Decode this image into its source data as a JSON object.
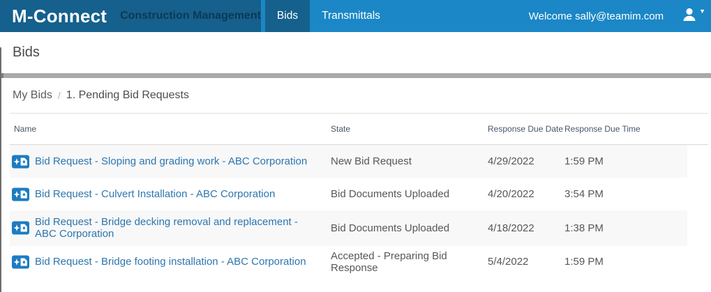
{
  "topbar": {
    "logo": "M-Connect",
    "app_name": "Construction Management",
    "nav": [
      {
        "label": "Bids",
        "active": true
      },
      {
        "label": "Transmittals",
        "active": false
      }
    ],
    "welcome": "Welcome sally@teamim.com",
    "user_icon": "user-icon",
    "caret_icon": "caret-down-icon",
    "bar_color": "#1b87c6",
    "dark_color": "#15608c"
  },
  "page": {
    "title": "Bids"
  },
  "breadcrumb": {
    "items": [
      "My Bids",
      "1. Pending Bid Requests"
    ],
    "separator": "/"
  },
  "table": {
    "columns": [
      "Name",
      "State",
      "Response Due Date",
      "Response Due Time"
    ],
    "row_icon": "bid-request-document-icon",
    "rows": [
      {
        "name": "Bid Request - Sloping and grading work - ABC Corporation",
        "state": "New Bid Request",
        "due_date": "4/29/2022",
        "due_time": "1:59 PM"
      },
      {
        "name": "Bid Request - Culvert Installation - ABC Corporation",
        "state": "Bid Documents Uploaded",
        "due_date": "4/20/2022",
        "due_time": "3:54 PM"
      },
      {
        "name": "Bid Request - Bridge decking removal and replacement - ABC Corporation",
        "state": "Bid Documents Uploaded",
        "due_date": "4/18/2022",
        "due_time": "1:38 PM"
      },
      {
        "name": "Bid Request - Bridge footing installation - ABC Corporation",
        "state": "Accepted - Preparing Bid Response",
        "due_date": "5/4/2022",
        "due_time": "1:59 PM"
      }
    ],
    "link_color": "#2d76ad",
    "alt_row_color": "#f8f8f9"
  }
}
